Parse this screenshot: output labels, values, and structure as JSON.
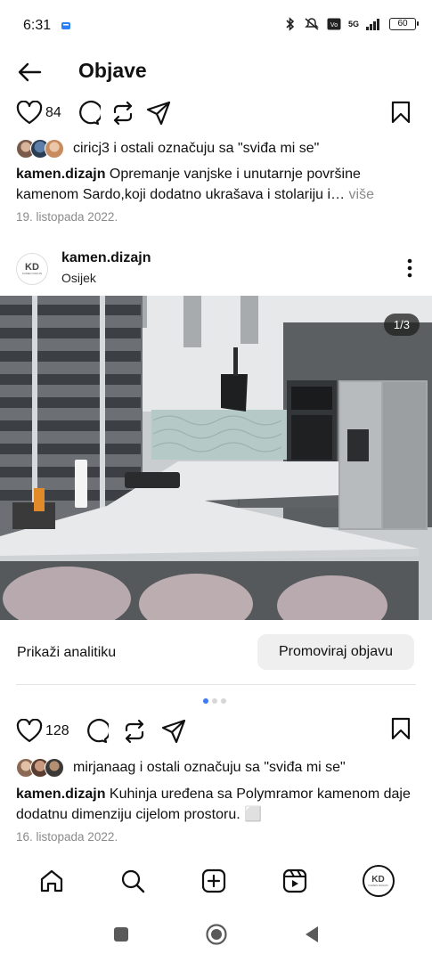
{
  "status_bar": {
    "time": "6:31",
    "network": "5G",
    "battery": "60"
  },
  "header": {
    "title": "Objave"
  },
  "post1": {
    "like_count": "84",
    "liked_by": "ciricj3",
    "liked_by_suffix": " i ostali označuju sa \"sviđa mi se\"",
    "caption_user": "kamen.dizajn",
    "caption_text": " Opremanje vanjske i unutarnje površine kamenom Sardo,koji dodatno ukrašava i stolariju i…",
    "more_label": " više",
    "date": "19. listopada 2022."
  },
  "post2": {
    "username": "kamen.dizajn",
    "location": "Osijek",
    "image_counter": "1/3",
    "analytics_label": "Prikaži analitiku",
    "promote_label": "Promoviraj objavu",
    "like_count": "128",
    "liked_by": "mirjanaag",
    "liked_by_suffix": " i ostali označuju sa \"sviđa mi se\"",
    "caption_user": "kamen.dizajn",
    "caption_text": " Kuhinja uređena sa Polymramor kamenom daje dodatnu dimenziju cijelom prostoru. ⬜",
    "date": "16. listopada 2022."
  },
  "avatar_logo": {
    "mark": "KD",
    "sub": "KAMEN DIZAJN"
  },
  "colors": {
    "carousel_active_dot": "#3b7cf5",
    "muted_text": "#8a8a8a"
  },
  "bottom_nav": [
    "home-icon",
    "search-icon",
    "create-icon",
    "reels-icon",
    "profile-avatar"
  ]
}
